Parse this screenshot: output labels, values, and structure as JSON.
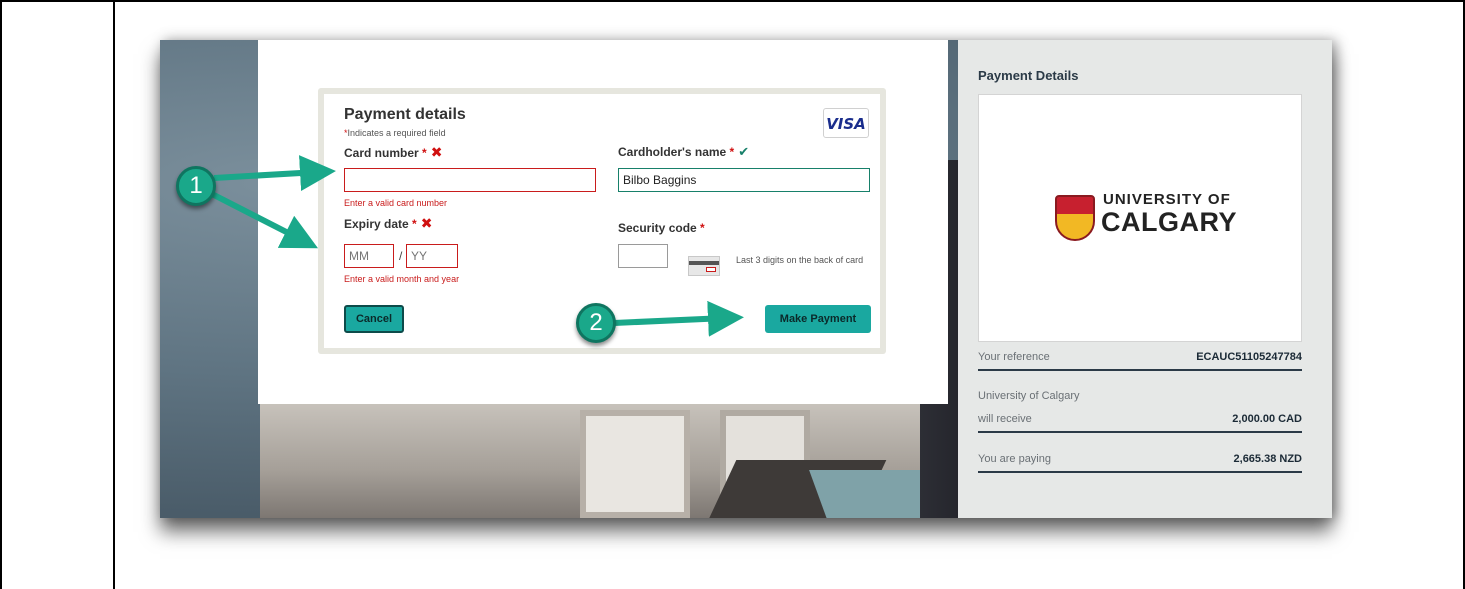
{
  "form": {
    "title": "Payment details",
    "required_note": "Indicates a required field",
    "card_brand": "VISA",
    "card_number": {
      "label": "Card number",
      "error": "Enter a valid card number",
      "value": ""
    },
    "cardholder": {
      "label": "Cardholder's name",
      "value": "Bilbo Baggins"
    },
    "expiry": {
      "label": "Expiry date",
      "month_placeholder": "MM",
      "year_placeholder": "YY",
      "separator": "/",
      "error": "Enter a valid month and year"
    },
    "security": {
      "label": "Security code",
      "hint": "Last 3 digits on the back of card",
      "value": ""
    },
    "cancel_label": "Cancel",
    "pay_label": "Make Payment"
  },
  "side": {
    "title": "Payment Details",
    "logo_line1": "UNIVERSITY OF",
    "logo_line2": "CALGARY",
    "reference_label": "Your reference",
    "reference_value": "ECAUC51105247784",
    "receiver_line1": "University of Calgary",
    "receiver_line2": "will receive",
    "receiver_value": "2,000.00 CAD",
    "paying_label": "You are paying",
    "paying_value": "2,665.38 NZD"
  },
  "annotations": {
    "step1": "1",
    "step2": "2"
  },
  "colors": {
    "accent": "#1aa8a0",
    "error": "#c91c1c",
    "valid": "#17806a",
    "arrow": "#1aa88a"
  },
  "icons": {
    "error": "cross-icon",
    "valid": "check-icon",
    "card": "card-back-icon"
  }
}
